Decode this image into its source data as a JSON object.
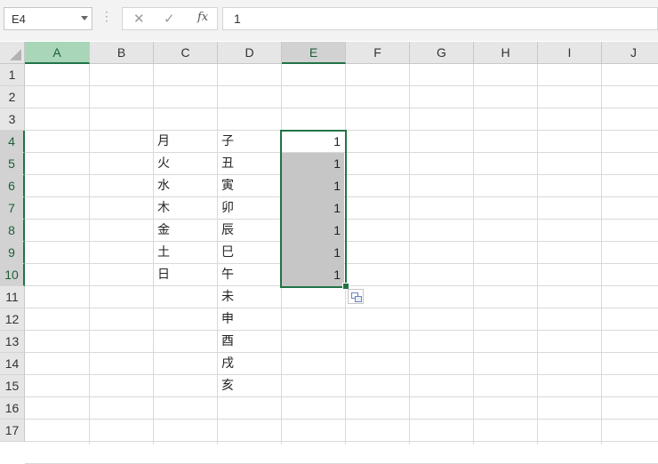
{
  "formula_bar": {
    "name_box": "E4",
    "cancel_icon": "✕",
    "enter_icon": "✓",
    "fx_label": "fx",
    "formula_value": "1"
  },
  "grid": {
    "columns": [
      "A",
      "B",
      "C",
      "D",
      "E",
      "F",
      "G",
      "H",
      "I",
      "J"
    ],
    "rows": [
      "1",
      "2",
      "3",
      "4",
      "5",
      "6",
      "7",
      "8",
      "9",
      "10",
      "11",
      "12",
      "13",
      "14",
      "15",
      "16",
      "17"
    ],
    "selected_column": "E",
    "active_cell": "E4",
    "selection_range": "E4:E10",
    "header_highlight_color": "#a9d6b8",
    "selection_border_color": "#217346"
  },
  "column_c": [
    "月",
    "火",
    "水",
    "木",
    "金",
    "土",
    "日"
  ],
  "column_d": [
    "子",
    "丑",
    "寅",
    "卯",
    "辰",
    "巳",
    "午",
    "未",
    "申",
    "酉",
    "戌",
    "亥"
  ],
  "column_e": [
    "1",
    "1",
    "1",
    "1",
    "1",
    "1",
    "1"
  ],
  "quick_analysis_icon": "auto-fill-options-icon"
}
